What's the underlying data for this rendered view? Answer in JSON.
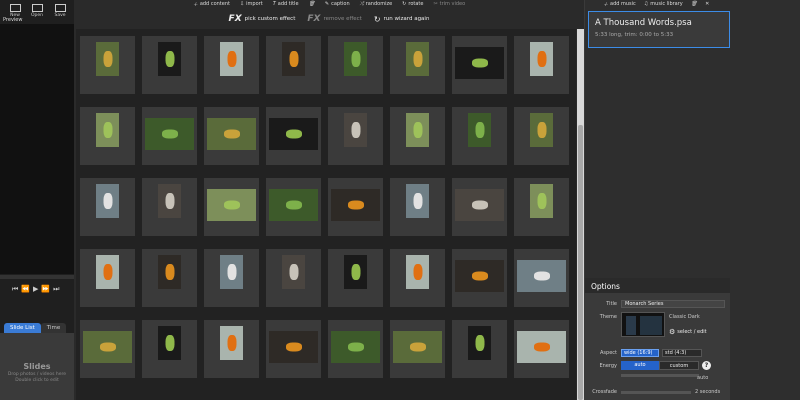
{
  "toolbar": {
    "new_label": "New",
    "open_label": "Open",
    "save_label": "Save",
    "preview_label": "Preview"
  },
  "center_toolbar": {
    "add_content": "add content",
    "import": "import",
    "add_title": "add title",
    "caption": "caption",
    "randomize": "randomize",
    "rotate": "rotate",
    "trim_video": "trim video"
  },
  "fx_bar": {
    "pick_custom_effect": "pick custom effect",
    "remove_effect": "remove effect",
    "run_wizard_again": "run wizard again"
  },
  "tabs": {
    "slide_list": "Slide List",
    "timeline": "Time"
  },
  "slides_panel": {
    "title": "Slides",
    "subtitle_1": "Drop photos / videos here",
    "subtitle_2": "Double click to edit"
  },
  "music_toolbar": {
    "add_music": "add music",
    "music_library": "music library"
  },
  "track": {
    "title": "A Thousand Words.psa",
    "subtitle": "5:33 long, trim: 0:00 to 5:33"
  },
  "options": {
    "heading": "Options",
    "title_label": "Title",
    "title_value": "Monarch Series",
    "theme_label": "Theme",
    "theme_name": "Classic Dark",
    "select_edit": "select / edit",
    "aspect_label": "Aspect",
    "aspect_wide": "wide (16:9)",
    "aspect_std": "std (4:3)",
    "energy_label": "Energy",
    "energy_auto": "auto",
    "energy_custom": "custom",
    "energy_slider_value": "auto",
    "crossfade_label": "Crossfade",
    "crossfade_value": "2 seconds"
  },
  "colors": {
    "accent": "#3c8ce7",
    "selected_button": "#2563c9"
  },
  "thumbnails": [
    "p",
    "p",
    "p",
    "p",
    "p",
    "p",
    "l",
    "p",
    "p",
    "l",
    "l",
    "l",
    "p",
    "p",
    "p",
    "p",
    "p",
    "p",
    "l",
    "l",
    "l",
    "p",
    "l",
    "p",
    "p",
    "p",
    "p",
    "p",
    "p",
    "p",
    "l",
    "l",
    "l",
    "p",
    "p",
    "l",
    "l",
    "l",
    "p",
    "l"
  ]
}
